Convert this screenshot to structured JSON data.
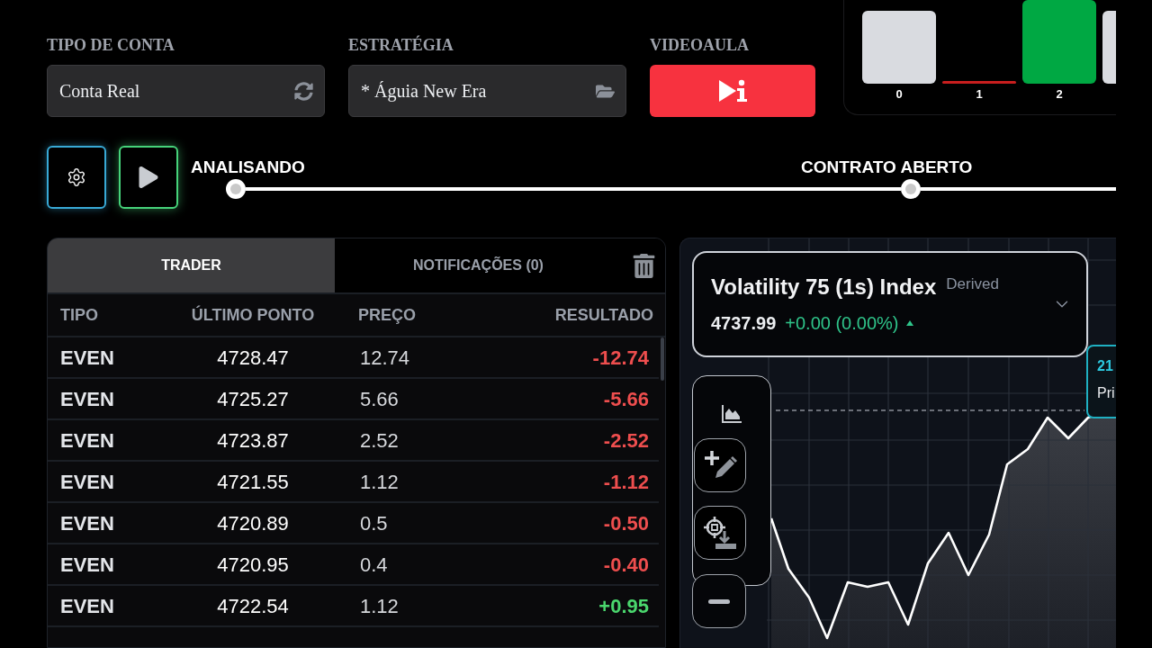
{
  "account_type": {
    "label": "TIPO DE CONTA",
    "value": "Conta Real"
  },
  "strategy": {
    "label": "ESTRATÉGIA",
    "value": "* Águia New Era"
  },
  "video_lesson": {
    "label": "VIDEOAULA"
  },
  "digit_bars": [
    {
      "label": "0",
      "color": "#d9dbe0"
    },
    {
      "label": "1",
      "color": "#c81e1e"
    },
    {
      "label": "2",
      "color": "#00a843"
    },
    {
      "color": "#d9dbe0"
    }
  ],
  "progress_steps": [
    {
      "label": "ANALISANDO"
    },
    {
      "label": "CONTRATO ABERTO"
    }
  ],
  "trade_panel": {
    "tabs": [
      {
        "label": "TRADER",
        "selected": true
      },
      {
        "label": "NOTIFICAÇÕES (0)",
        "selected": false
      }
    ],
    "columns": [
      "TIPO",
      "ÚLTIMO PONTO",
      "PREÇO",
      "RESULTADO"
    ],
    "rows": [
      {
        "type": "EVEN",
        "last_point": "4728.47",
        "price": "12.74",
        "result": "-12.74",
        "win": false
      },
      {
        "type": "EVEN",
        "last_point": "4725.27",
        "price": "5.66",
        "result": "-5.66",
        "win": false
      },
      {
        "type": "EVEN",
        "last_point": "4723.87",
        "price": "2.52",
        "result": "-2.52",
        "win": false
      },
      {
        "type": "EVEN",
        "last_point": "4721.55",
        "price": "1.12",
        "result": "-1.12",
        "win": false
      },
      {
        "type": "EVEN",
        "last_point": "4720.89",
        "price": "0.5",
        "result": "-0.50",
        "win": false
      },
      {
        "type": "EVEN",
        "last_point": "4720.95",
        "price": "0.4",
        "result": "-0.40",
        "win": false
      },
      {
        "type": "EVEN",
        "last_point": "4722.54",
        "price": "1.12",
        "result": "+0.95",
        "win": true
      }
    ]
  },
  "chart_panel": {
    "symbol": "Volatility 75 (1s) Index",
    "category": "Derived",
    "price": "4737.99",
    "change": "+0.00 (0.00%)",
    "tooltip": {
      "value": "21",
      "label": "Pri"
    }
  }
}
